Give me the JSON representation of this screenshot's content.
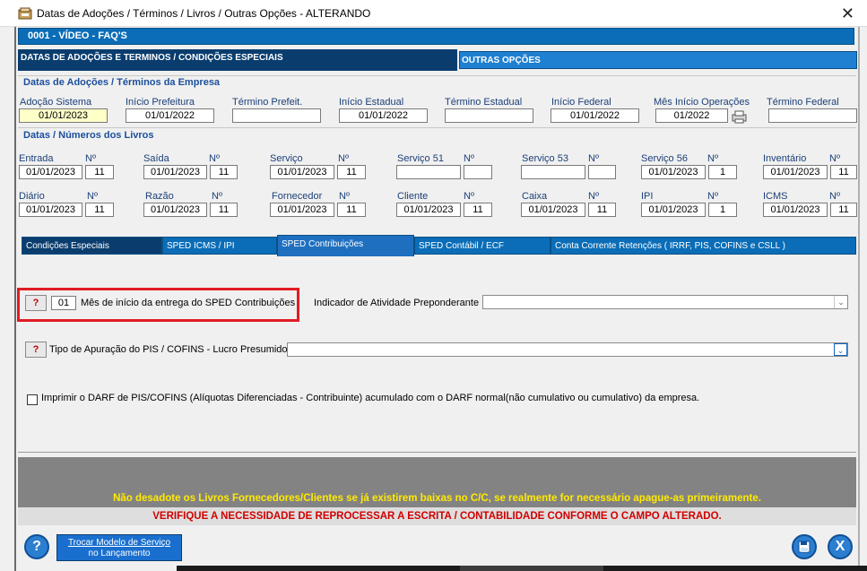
{
  "window": {
    "title": "Datas de Adoções / Términos / Livros / Outras Opções   -   ALTERANDO",
    "close_label": "✕"
  },
  "record_bar": "0001   -   VÍDEO - FAQ'S",
  "top_tabs": {
    "left": "DATAS DE ADOÇÕES E TERMINOS / CONDIÇÕES ESPECIAIS",
    "right": "OUTRAS OPÇÕES"
  },
  "adocoes": {
    "title": "Datas de Adoções / Términos da Empresa",
    "fields": [
      {
        "label": "Adoção Sistema",
        "value": "01/01/2023"
      },
      {
        "label": "Início Prefeitura",
        "value": "01/01/2022"
      },
      {
        "label": "Término Prefeit.",
        "value": ""
      },
      {
        "label": "Início Estadual",
        "value": "01/01/2022"
      },
      {
        "label": "Término Estadual",
        "value": ""
      },
      {
        "label": "Início Federal",
        "value": "01/01/2022"
      },
      {
        "label": "Mês Início Operações",
        "value": "01/2022"
      },
      {
        "label": "Término Federal",
        "value": ""
      }
    ]
  },
  "livros": {
    "title": "Datas / Números dos Livros",
    "num_label": "Nº",
    "row1": [
      {
        "label": "Entrada",
        "date": "01/01/2023",
        "num": "11"
      },
      {
        "label": "Saída",
        "date": "01/01/2023",
        "num": "11"
      },
      {
        "label": "Serviço",
        "date": "01/01/2023",
        "num": "11"
      },
      {
        "label": "Serviço 51",
        "date": "",
        "num": ""
      },
      {
        "label": "Serviço 53",
        "date": "",
        "num": ""
      },
      {
        "label": "Serviço 56",
        "date": "01/01/2023",
        "num": "1"
      },
      {
        "label": "Inventário",
        "date": "01/01/2023",
        "num": "11"
      }
    ],
    "row2": [
      {
        "label": "Diário",
        "date": "01/01/2023",
        "num": "11"
      },
      {
        "label": "Razão",
        "date": "01/01/2023",
        "num": "11"
      },
      {
        "label": "Fornecedor",
        "date": "01/01/2023",
        "num": "11"
      },
      {
        "label": "Cliente",
        "date": "01/01/2023",
        "num": "11"
      },
      {
        "label": "Caixa",
        "date": "01/01/2023",
        "num": "11"
      },
      {
        "label": "IPI",
        "date": "01/01/2023",
        "num": "1"
      },
      {
        "label": "ICMS",
        "date": "01/01/2023",
        "num": "11"
      }
    ]
  },
  "sub_tabs": [
    "Condições Especiais",
    "SPED ICMS / IPI",
    "SPED Contribuições",
    "SPED Contábil / ECF",
    "Conta Corrente Retenções ( IRRF, PIS, COFINS  e  CSLL )"
  ],
  "sped": {
    "help_label": "?",
    "mes_value": "01",
    "mes_label": "Mês de início da entrega do SPED Contribuições",
    "indicador_label": "Indicador de Atividade Preponderante",
    "indicador_value": "",
    "tipo_label": "Tipo de Apuração do PIS / COFINS - Lucro Presumido:",
    "tipo_value": "",
    "darf_label": "Imprimir o DARF de PIS/COFINS (Alíquotas Diferenciadas - Contribuinte) acumulado com o DARF normal(não cumulativo ou cumulativo) da empresa.",
    "darf_checked": false
  },
  "warnings": {
    "yellow": "Não desadote os Livros Fornecedores/Clientes se já existirem baixas no C/C, se realmente for necessário apague-as primeiramente.",
    "red": "VERIFIQUE A NECESSIDADE DE REPROCESSAR A ESCRITA / CONTABILIDADE CONFORME O CAMPO ALTERADO."
  },
  "footer": {
    "help_icon": "?",
    "trocar_line1": "Trocar Modelo de Serviço",
    "trocar_line2": "no Lançamento",
    "close_icon": "X"
  },
  "colors": {
    "accent": "#0b6db7",
    "dark_tab": "#0a3d6e",
    "warning_yellow": "#ffea00",
    "warning_red": "#d20000",
    "highlight_box": "#e21b23"
  }
}
